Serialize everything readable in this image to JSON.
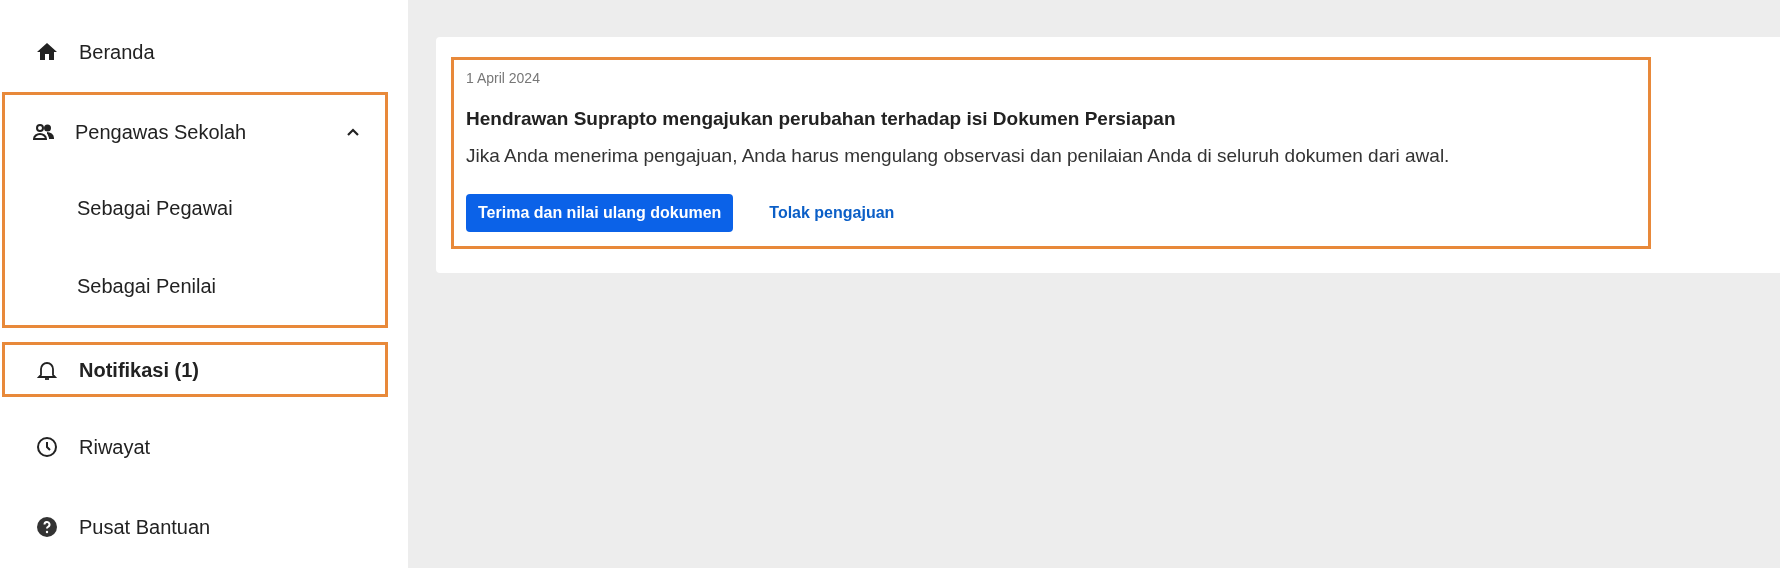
{
  "sidebar": {
    "items": [
      {
        "kind": "link",
        "label": "Beranda",
        "selected": false,
        "highlighted": false
      },
      {
        "kind": "group",
        "label": "Pengawas Sekolah",
        "expanded": true,
        "highlighted": true,
        "children": [
          {
            "label": "Sebagai Pegawai",
            "selected": false
          },
          {
            "label": "Sebagai Penilai",
            "selected": false
          }
        ]
      },
      {
        "kind": "link",
        "label": "Notifikasi (1)",
        "selected": true,
        "highlighted": true
      },
      {
        "kind": "link",
        "label": "Riwayat",
        "selected": false,
        "highlighted": false
      },
      {
        "kind": "link",
        "label": "Pusat Bantuan",
        "selected": false,
        "highlighted": false
      }
    ]
  },
  "notifications": [
    {
      "date": "1 April 2024",
      "title": "Hendrawan Suprapto mengajukan perubahan terhadap isi Dokumen Persiapan",
      "body": "Jika Anda menerima pengajuan, Anda harus mengulang observasi dan penilaian Anda di seluruh dokumen dari awal.",
      "highlighted": true,
      "primary_action": "Terima dan nilai ulang dokumen",
      "secondary_action": "Tolak pengajuan"
    }
  ]
}
